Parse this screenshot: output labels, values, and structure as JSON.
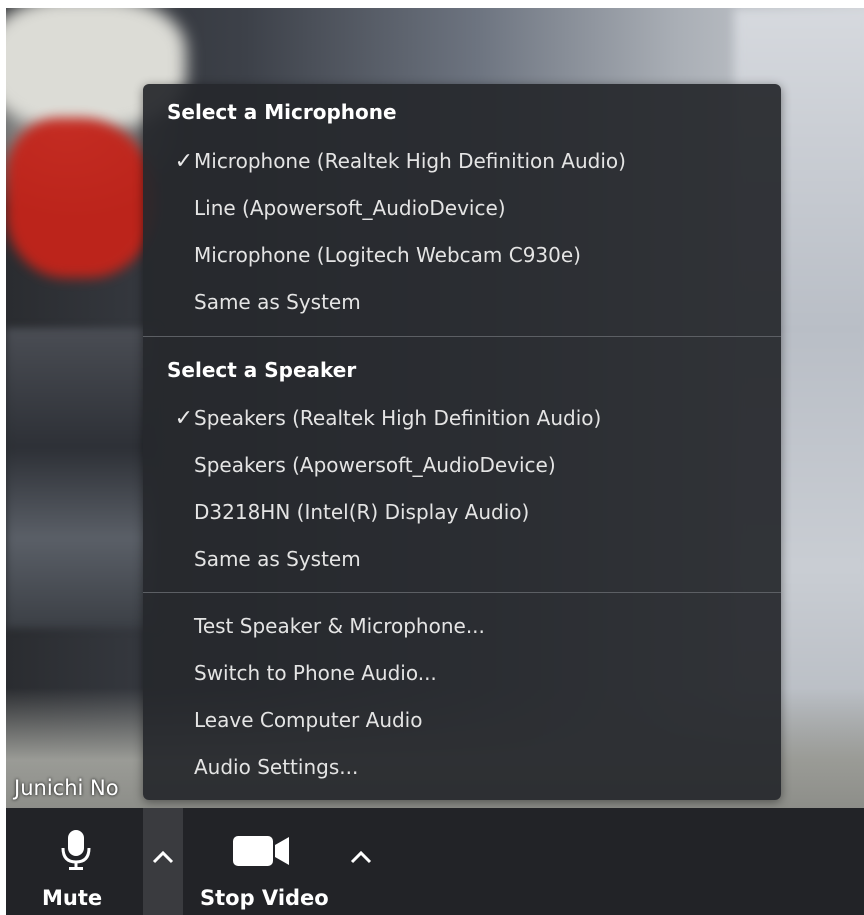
{
  "participant": {
    "name": "Junichi No"
  },
  "audio_menu": {
    "microphone_section": {
      "title": "Select a Microphone",
      "items": [
        {
          "label": "Microphone (Realtek High Definition Audio)",
          "selected": true
        },
        {
          "label": "Line (Apowersoft_AudioDevice)",
          "selected": false
        },
        {
          "label": "Microphone (Logitech Webcam C930e)",
          "selected": false
        },
        {
          "label": "Same as System",
          "selected": false
        }
      ]
    },
    "speaker_section": {
      "title": "Select a Speaker",
      "items": [
        {
          "label": "Speakers (Realtek High Definition Audio)",
          "selected": true
        },
        {
          "label": "Speakers (Apowersoft_AudioDevice)",
          "selected": false
        },
        {
          "label": "D3218HN (Intel(R) Display Audio)",
          "selected": false
        },
        {
          "label": "Same as System",
          "selected": false
        }
      ]
    },
    "actions": [
      {
        "label": "Test Speaker & Microphone..."
      },
      {
        "label": "Switch to Phone Audio..."
      },
      {
        "label": "Leave Computer Audio"
      },
      {
        "label": "Audio Settings..."
      }
    ],
    "check_glyph": "✓"
  },
  "toolbar": {
    "mute_label": "Mute",
    "stop_video_label": "Stop Video",
    "icons": {
      "mute": "microphone-icon",
      "audio_options": "chevron-up-icon",
      "video": "video-camera-icon",
      "video_options": "chevron-up-icon"
    }
  },
  "colors": {
    "menu_background": "#26282c",
    "toolbar_background": "#222327",
    "text": "#ffffff"
  }
}
